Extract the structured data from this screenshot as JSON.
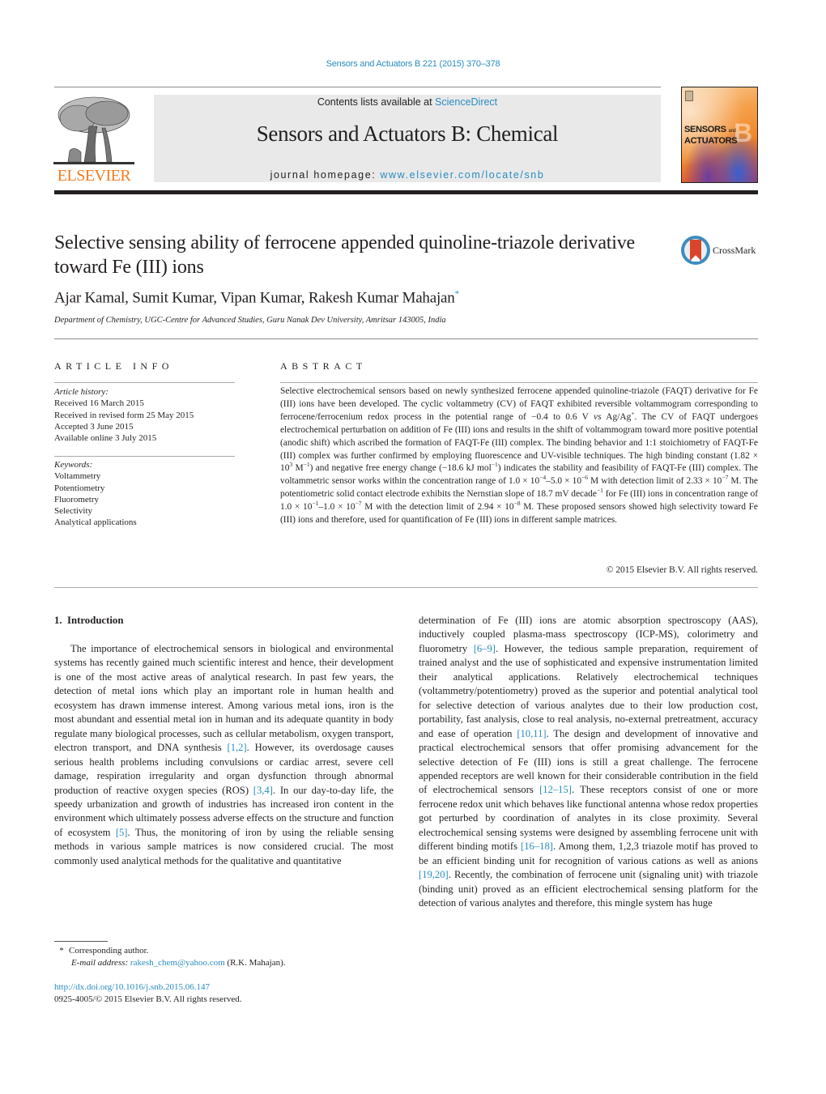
{
  "journal_reference": "Sensors and Actuators B 221 (2015) 370–378",
  "header": {
    "contents_prefix": "Contents lists available at ",
    "contents_link": "ScienceDirect",
    "journal_title": "Sensors and Actuators B: Chemical",
    "homepage_prefix": "journal homepage: ",
    "homepage_link": "www.elsevier.com/locate/snb",
    "publisher_logo_text": "ELSEVIER",
    "cover": {
      "line1": "SENSORS",
      "line1_small": "and",
      "line2": "ACTUATORS",
      "letter": "B"
    },
    "colors": {
      "link": "#2a8cbf",
      "elsevier_orange": "#f47b20",
      "band": "#e9e9ea"
    }
  },
  "article": {
    "title": "Selective sensing ability of ferrocene appended quinoline-triazole derivative toward Fe (III) ions",
    "crossmark_label": "CrossMark",
    "authors": "Ajar Kamal, Sumit Kumar, Vipan Kumar, Rakesh Kumar Mahajan",
    "corresponding_mark": "*",
    "affiliation": "Department of Chemistry, UGC-Centre for Advanced Studies, Guru Nanak Dev University, Amritsar 143005, India"
  },
  "article_info": {
    "heading": "ARTICLE INFO",
    "history_label": "Article history:",
    "history": [
      "Received 16 March 2015",
      "Received in revised form 25 May 2015",
      "Accepted 3 June 2015",
      "Available online 3 July 2015"
    ],
    "keywords_label": "Keywords:",
    "keywords": [
      "Voltammetry",
      "Potentiometry",
      "Fluorometry",
      "Selectivity",
      "Analytical applications"
    ]
  },
  "abstract": {
    "heading": "ABSTRACT",
    "parts": {
      "p1": "Selective electrochemical sensors based on newly synthesized ferrocene appended quinoline-triazole (FAQT) derivative for Fe (III) ions have been developed. The cyclic voltammetry (CV) of FAQT exhibited reversible voltammogram corresponding to ferrocene/ferrocenium redox process in the potential range of −0.4 to 0.6 V ",
      "vs": "vs",
      "p2": " Ag/Ag",
      "p2_sup": "+",
      "p3": ". The CV of FAQT undergoes electrochemical perturbation on addition of Fe (III) ions and results in the shift of voltammogram toward more positive potential (anodic shift) which ascribed the formation of FAQT-Fe (III) complex. The binding behavior and 1:1 stoichiometry of FAQT-Fe (III) complex was further confirmed by employing fluorescence and UV-visible techniques. The high binding constant (1.82 × 10",
      "s1": "3",
      "p4": " M",
      "s2": "−1",
      "p5": ") and negative free energy change (−18.6 kJ mol",
      "s3": "−1",
      "p6": ") indicates the stability and feasibility of FAQT-Fe (III) complex. The voltammetric sensor works within the concentration range of 1.0 × 10",
      "s4": "−4",
      "p7": "–5.0 × 10",
      "s5": "−6",
      "p8": " M with detection limit of 2.33 × 10",
      "s6": "−7",
      "p9": " M. The potentiometric solid contact electrode exhibits the Nernstian slope of 18.7 mV decade",
      "s7": "−1",
      "p10": " for Fe (III) ions in concentration range of 1.0 × 10",
      "s8": "−1",
      "p11": "–1.0 × 10",
      "s9": "−7",
      "p12": " M with the detection limit of 2.94 × 10",
      "s10": "−8",
      "p13": " M. These proposed sensors showed high selectivity toward Fe (III) ions and therefore, used for quantification of Fe (III) ions in different sample matrices."
    },
    "copyright": "© 2015 Elsevier B.V. All rights reserved."
  },
  "introduction": {
    "heading": "1.  Introduction",
    "left": {
      "t1": "The importance of electrochemical sensors in biological and environmental systems has recently gained much scientific interest and hence, their development is one of the most active areas of analytical research. In past few years, the detection of metal ions which play an important role in human health and ecosystem has drawn immense interest. Among various metal ions, iron is the most abundant and essential metal ion in human and its adequate quantity in body regulate many biological processes, such as cellular metabolism, oxygen transport, electron transport, and DNA synthesis ",
      "r1": "[1,2]",
      "t2": ". However, its overdosage causes serious health problems including convulsions or cardiac arrest, severe cell damage, respiration irregularity and organ dysfunction through abnormal production of reactive oxygen species (ROS) ",
      "r2": "[3,4]",
      "t3": ". In our day-to-day life, the speedy urbanization and growth of industries has increased iron content in the environment which ultimately possess adverse effects on the structure and function of ecosystem ",
      "r3": "[5]",
      "t4": ". Thus, the monitoring of iron by using the reliable sensing methods in various sample matrices is now considered crucial. The most commonly used analytical methods for the qualitative and quantitative"
    },
    "right": {
      "t1": "determination of Fe (III) ions are atomic absorption spectroscopy (AAS), inductively coupled plasma-mass spectroscopy (ICP-MS), colorimetry and fluorometry ",
      "r1": "[6–9]",
      "t2": ". However, the tedious sample preparation, requirement of trained analyst and the use of sophisticated and expensive instrumentation limited their analytical applications. Relatively electrochemical techniques (voltammetry/potentiometry) proved as the superior and potential analytical tool for selective detection of various analytes due to their low production cost, portability, fast analysis, close to real analysis, no-external pretreatment, accuracy and ease of operation ",
      "r2": "[10,11]",
      "t3": ". The design and development of innovative and practical electrochemical sensors that offer promising advancement for the selective detection of Fe (III) ions is still a great challenge. The ferrocene appended receptors are well known for their considerable contribution in the field of electrochemical sensors ",
      "r3": "[12–15]",
      "t4": ". These receptors consist of one or more ferrocene redox unit which behaves like functional antenna whose redox properties got perturbed by coordination of analytes in its close proximity. Several electrochemical sensing systems were designed by assembling ferrocene unit with different binding motifs ",
      "r4": "[16–18]",
      "t5": ". Among them, 1,2,3 triazole motif has proved to be an efficient binding unit for recognition of various cations as well as anions ",
      "r5": "[19,20]",
      "t6": ". Recently, the combination of ferrocene unit (signaling unit) with triazole (binding unit) proved as an efficient electrochemical sensing platform for the detection of various analytes and therefore, this mingle system has huge"
    }
  },
  "footnote": {
    "star": "*",
    "corresponding": "Corresponding author.",
    "email_label": "E-mail address:",
    "email": "rakesh_chem@yahoo.com",
    "email_suffix": " (R.K. Mahajan).",
    "doi": "http://dx.doi.org/10.1016/j.snb.2015.06.147",
    "issn": "0925-4005/© 2015 Elsevier B.V. All rights reserved."
  }
}
